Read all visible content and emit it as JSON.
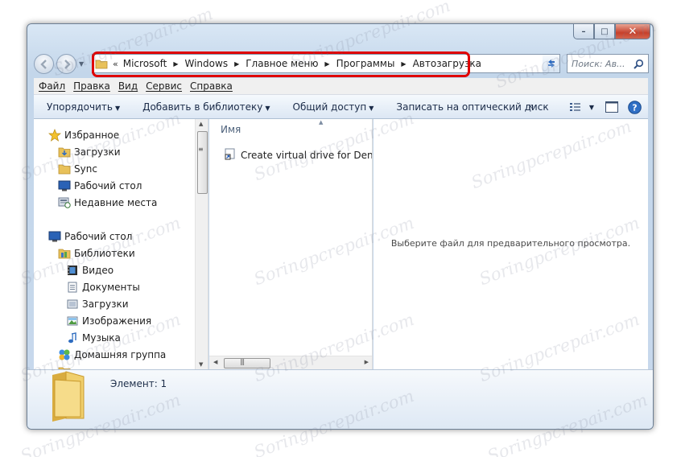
{
  "window": {
    "caption": {
      "minimize": "–",
      "maximize": "□",
      "close": "✕"
    }
  },
  "address": {
    "prefix": "«",
    "crumbs": [
      "Microsoft",
      "Windows",
      "Главное меню",
      "Программы",
      "Автозагрузка"
    ]
  },
  "search": {
    "placeholder": "Поиск: Ав..."
  },
  "menu": [
    "Файл",
    "Правка",
    "Вид",
    "Сервис",
    "Справка"
  ],
  "commands": [
    "Упорядочить",
    "Добавить в библиотеку",
    "Общий доступ",
    "Записать на оптический диск"
  ],
  "command_more": "»",
  "nav_tree": [
    {
      "label": "Избранное",
      "icon": "star-icon"
    },
    {
      "label": "Загрузки",
      "icon": "folder-icon"
    },
    {
      "label": "Sync",
      "icon": "folder-icon"
    },
    {
      "label": "Рабочий стол",
      "icon": "desktop-icon"
    },
    {
      "label": "Недавние места",
      "icon": "recent-places-icon"
    },
    {
      "label": "Рабочий стол",
      "icon": "desktop-icon"
    },
    {
      "label": "Библиотеки",
      "icon": "libraries-icon"
    },
    {
      "label": "Видео",
      "icon": "video-icon"
    },
    {
      "label": "Документы",
      "icon": "documents-icon"
    },
    {
      "label": "Загрузки",
      "icon": "downloads-icon"
    },
    {
      "label": "Изображения",
      "icon": "pictures-icon"
    },
    {
      "label": "Музыка",
      "icon": "music-icon"
    },
    {
      "label": "Домашняя группа",
      "icon": "homegroup-icon"
    }
  ],
  "file_list": {
    "column_name": "Имя",
    "items": [
      {
        "name": "Create virtual drive for Denwer",
        "icon": "shortcut-icon"
      }
    ]
  },
  "preview": {
    "message": "Выберите файл для предварительного просмотра."
  },
  "details": {
    "text": "Элемент: 1"
  },
  "watermark": "Soringpcrepair.com"
}
